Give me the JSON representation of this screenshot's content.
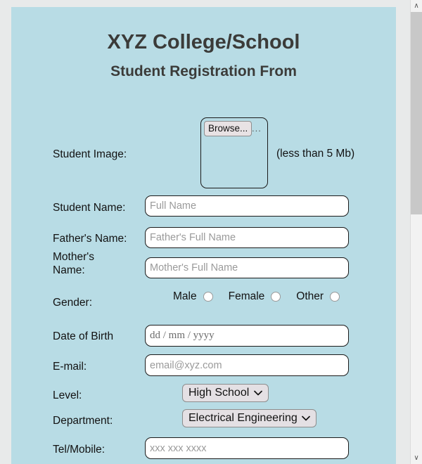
{
  "header": {
    "title": "XYZ College/School",
    "subtitle": "Student Registration From"
  },
  "form": {
    "student_image": {
      "label": "Student Image:",
      "browse_label": "Browse...",
      "ellipsis": "...",
      "note": "(less than 5 Mb)"
    },
    "student_name": {
      "label": "Student Name:",
      "placeholder": "Full Name",
      "value": ""
    },
    "fathers_name": {
      "label": "Father's Name:",
      "placeholder": "Father's Full Name",
      "value": ""
    },
    "mothers_name": {
      "label": "Mother's Name:",
      "placeholder": "Mother's Full Name",
      "value": ""
    },
    "gender": {
      "label": "Gender:",
      "options": [
        {
          "label": "Male",
          "selected": false
        },
        {
          "label": "Female",
          "selected": false
        },
        {
          "label": "Other",
          "selected": false
        }
      ]
    },
    "date_of_birth": {
      "label": "Date of Birth",
      "placeholder": "dd / mm / yyyy",
      "value": ""
    },
    "email": {
      "label": "E-mail:",
      "placeholder": "email@xyz.com",
      "value": ""
    },
    "level": {
      "label": "Level:",
      "selected": "High School",
      "options": [
        "High School"
      ]
    },
    "department": {
      "label": "Department:",
      "selected": "Electrical Engineering",
      "options": [
        "Electrical Engineering"
      ]
    },
    "telephone": {
      "label": "Tel/Mobile:",
      "placeholder": "xxx xxx xxxx",
      "value": ""
    }
  },
  "scrollbar": {
    "up_glyph": "∧",
    "down_glyph": "∨"
  },
  "colors": {
    "panel_background": "#b8dce5",
    "page_background": "#e8eaea",
    "title_text": "#3b3b39",
    "input_border": "#1b1b1b",
    "select_background": "#e4e0e4"
  }
}
